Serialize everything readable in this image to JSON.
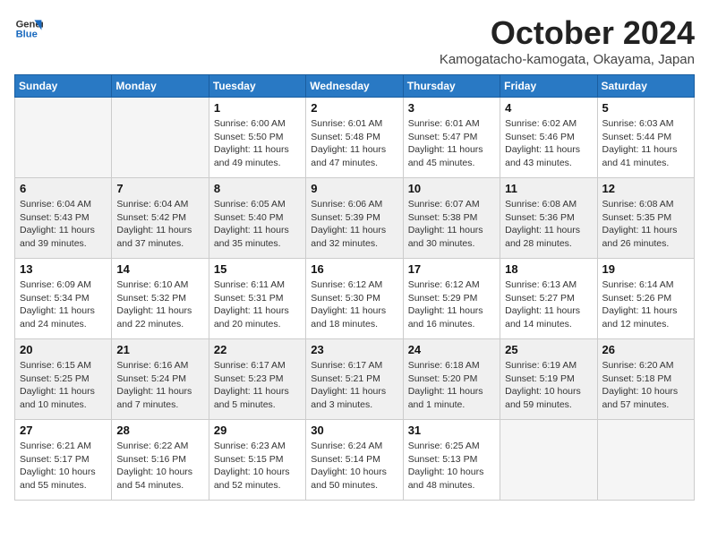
{
  "logo": {
    "line1": "General",
    "line2": "Blue"
  },
  "title": "October 2024",
  "location": "Kamogatacho-kamogata, Okayama, Japan",
  "weekdays": [
    "Sunday",
    "Monday",
    "Tuesday",
    "Wednesday",
    "Thursday",
    "Friday",
    "Saturday"
  ],
  "weeks": [
    [
      {
        "day": "",
        "info": ""
      },
      {
        "day": "",
        "info": ""
      },
      {
        "day": "1",
        "info": "Sunrise: 6:00 AM\nSunset: 5:50 PM\nDaylight: 11 hours and 49 minutes."
      },
      {
        "day": "2",
        "info": "Sunrise: 6:01 AM\nSunset: 5:48 PM\nDaylight: 11 hours and 47 minutes."
      },
      {
        "day": "3",
        "info": "Sunrise: 6:01 AM\nSunset: 5:47 PM\nDaylight: 11 hours and 45 minutes."
      },
      {
        "day": "4",
        "info": "Sunrise: 6:02 AM\nSunset: 5:46 PM\nDaylight: 11 hours and 43 minutes."
      },
      {
        "day": "5",
        "info": "Sunrise: 6:03 AM\nSunset: 5:44 PM\nDaylight: 11 hours and 41 minutes."
      }
    ],
    [
      {
        "day": "6",
        "info": "Sunrise: 6:04 AM\nSunset: 5:43 PM\nDaylight: 11 hours and 39 minutes."
      },
      {
        "day": "7",
        "info": "Sunrise: 6:04 AM\nSunset: 5:42 PM\nDaylight: 11 hours and 37 minutes."
      },
      {
        "day": "8",
        "info": "Sunrise: 6:05 AM\nSunset: 5:40 PM\nDaylight: 11 hours and 35 minutes."
      },
      {
        "day": "9",
        "info": "Sunrise: 6:06 AM\nSunset: 5:39 PM\nDaylight: 11 hours and 32 minutes."
      },
      {
        "day": "10",
        "info": "Sunrise: 6:07 AM\nSunset: 5:38 PM\nDaylight: 11 hours and 30 minutes."
      },
      {
        "day": "11",
        "info": "Sunrise: 6:08 AM\nSunset: 5:36 PM\nDaylight: 11 hours and 28 minutes."
      },
      {
        "day": "12",
        "info": "Sunrise: 6:08 AM\nSunset: 5:35 PM\nDaylight: 11 hours and 26 minutes."
      }
    ],
    [
      {
        "day": "13",
        "info": "Sunrise: 6:09 AM\nSunset: 5:34 PM\nDaylight: 11 hours and 24 minutes."
      },
      {
        "day": "14",
        "info": "Sunrise: 6:10 AM\nSunset: 5:32 PM\nDaylight: 11 hours and 22 minutes."
      },
      {
        "day": "15",
        "info": "Sunrise: 6:11 AM\nSunset: 5:31 PM\nDaylight: 11 hours and 20 minutes."
      },
      {
        "day": "16",
        "info": "Sunrise: 6:12 AM\nSunset: 5:30 PM\nDaylight: 11 hours and 18 minutes."
      },
      {
        "day": "17",
        "info": "Sunrise: 6:12 AM\nSunset: 5:29 PM\nDaylight: 11 hours and 16 minutes."
      },
      {
        "day": "18",
        "info": "Sunrise: 6:13 AM\nSunset: 5:27 PM\nDaylight: 11 hours and 14 minutes."
      },
      {
        "day": "19",
        "info": "Sunrise: 6:14 AM\nSunset: 5:26 PM\nDaylight: 11 hours and 12 minutes."
      }
    ],
    [
      {
        "day": "20",
        "info": "Sunrise: 6:15 AM\nSunset: 5:25 PM\nDaylight: 11 hours and 10 minutes."
      },
      {
        "day": "21",
        "info": "Sunrise: 6:16 AM\nSunset: 5:24 PM\nDaylight: 11 hours and 7 minutes."
      },
      {
        "day": "22",
        "info": "Sunrise: 6:17 AM\nSunset: 5:23 PM\nDaylight: 11 hours and 5 minutes."
      },
      {
        "day": "23",
        "info": "Sunrise: 6:17 AM\nSunset: 5:21 PM\nDaylight: 11 hours and 3 minutes."
      },
      {
        "day": "24",
        "info": "Sunrise: 6:18 AM\nSunset: 5:20 PM\nDaylight: 11 hours and 1 minute."
      },
      {
        "day": "25",
        "info": "Sunrise: 6:19 AM\nSunset: 5:19 PM\nDaylight: 10 hours and 59 minutes."
      },
      {
        "day": "26",
        "info": "Sunrise: 6:20 AM\nSunset: 5:18 PM\nDaylight: 10 hours and 57 minutes."
      }
    ],
    [
      {
        "day": "27",
        "info": "Sunrise: 6:21 AM\nSunset: 5:17 PM\nDaylight: 10 hours and 55 minutes."
      },
      {
        "day": "28",
        "info": "Sunrise: 6:22 AM\nSunset: 5:16 PM\nDaylight: 10 hours and 54 minutes."
      },
      {
        "day": "29",
        "info": "Sunrise: 6:23 AM\nSunset: 5:15 PM\nDaylight: 10 hours and 52 minutes."
      },
      {
        "day": "30",
        "info": "Sunrise: 6:24 AM\nSunset: 5:14 PM\nDaylight: 10 hours and 50 minutes."
      },
      {
        "day": "31",
        "info": "Sunrise: 6:25 AM\nSunset: 5:13 PM\nDaylight: 10 hours and 48 minutes."
      },
      {
        "day": "",
        "info": ""
      },
      {
        "day": "",
        "info": ""
      }
    ]
  ]
}
